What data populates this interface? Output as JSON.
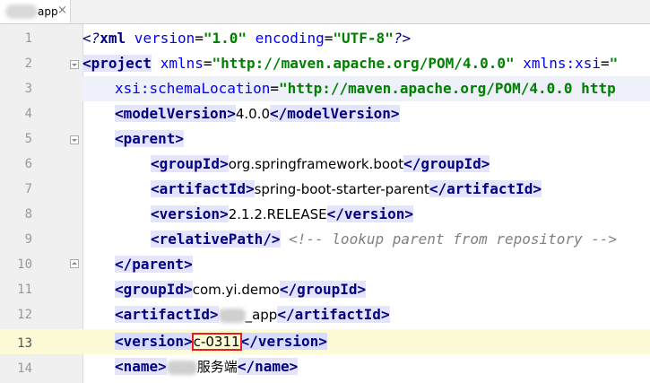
{
  "tab": {
    "label": "app",
    "close": "×"
  },
  "lines": [
    {
      "num": "1"
    },
    {
      "num": "2"
    },
    {
      "num": "3"
    },
    {
      "num": "4"
    },
    {
      "num": "5"
    },
    {
      "num": "6"
    },
    {
      "num": "7"
    },
    {
      "num": "8"
    },
    {
      "num": "9"
    },
    {
      "num": "10"
    },
    {
      "num": "11"
    },
    {
      "num": "12"
    },
    {
      "num": "13"
    },
    {
      "num": "14"
    }
  ],
  "code": {
    "l1": {
      "open": "<?",
      "name": "xml",
      "a1": " version",
      "eq1": "=",
      "v1": "\"1.0\"",
      "a2": " encoding",
      "eq2": "=",
      "v2": "\"UTF-8\"",
      "close": "?>"
    },
    "l2": {
      "open": "<project",
      "a1": " xmlns",
      "eq1": "=",
      "v1": "\"http://maven.apache.org/POM/4.0.0\"",
      "a2": " xmlns:xsi",
      "eq2": "=",
      "v2": "\""
    },
    "l3": {
      "a1": "xsi:schemaLocation",
      "eq1": "=",
      "v1": "\"http://maven.apache.org/POM/4.0.0 http"
    },
    "l4": {
      "open": "<modelVersion>",
      "text": "4.0.0",
      "close": "</modelVersion>"
    },
    "l5": {
      "open": "<parent>"
    },
    "l6": {
      "open": "<groupId>",
      "text": "org.springframework.boot",
      "close": "</groupId>"
    },
    "l7": {
      "open": "<artifactId>",
      "text": "spring-boot-starter-parent",
      "close": "</artifactId>"
    },
    "l8": {
      "open": "<version>",
      "text": "2.1.2.RELEASE",
      "close": "</version>"
    },
    "l9": {
      "open": "<relativePath/>",
      "comment": " <!-- lookup parent from repository -->"
    },
    "l10": {
      "close": "</parent>"
    },
    "l11": {
      "open": "<groupId>",
      "text": "com.yi.demo",
      "close": "</groupId>"
    },
    "l12": {
      "open": "<artifactId>",
      "text": "_app",
      "close": "</artifactId>"
    },
    "l13": {
      "open": "<version>",
      "text": "c-0311",
      "close": "</version>"
    },
    "l14": {
      "open": "<name>",
      "text": "服务端",
      "close": "</name>"
    }
  },
  "colors": {
    "tag": "#000080",
    "attr": "#0000ff",
    "value": "#008000",
    "comment": "#808080",
    "highlight_box": "#e81e1e"
  },
  "icons": {
    "bulb": "lightbulb-icon",
    "fold": "fold-marker-icon"
  }
}
